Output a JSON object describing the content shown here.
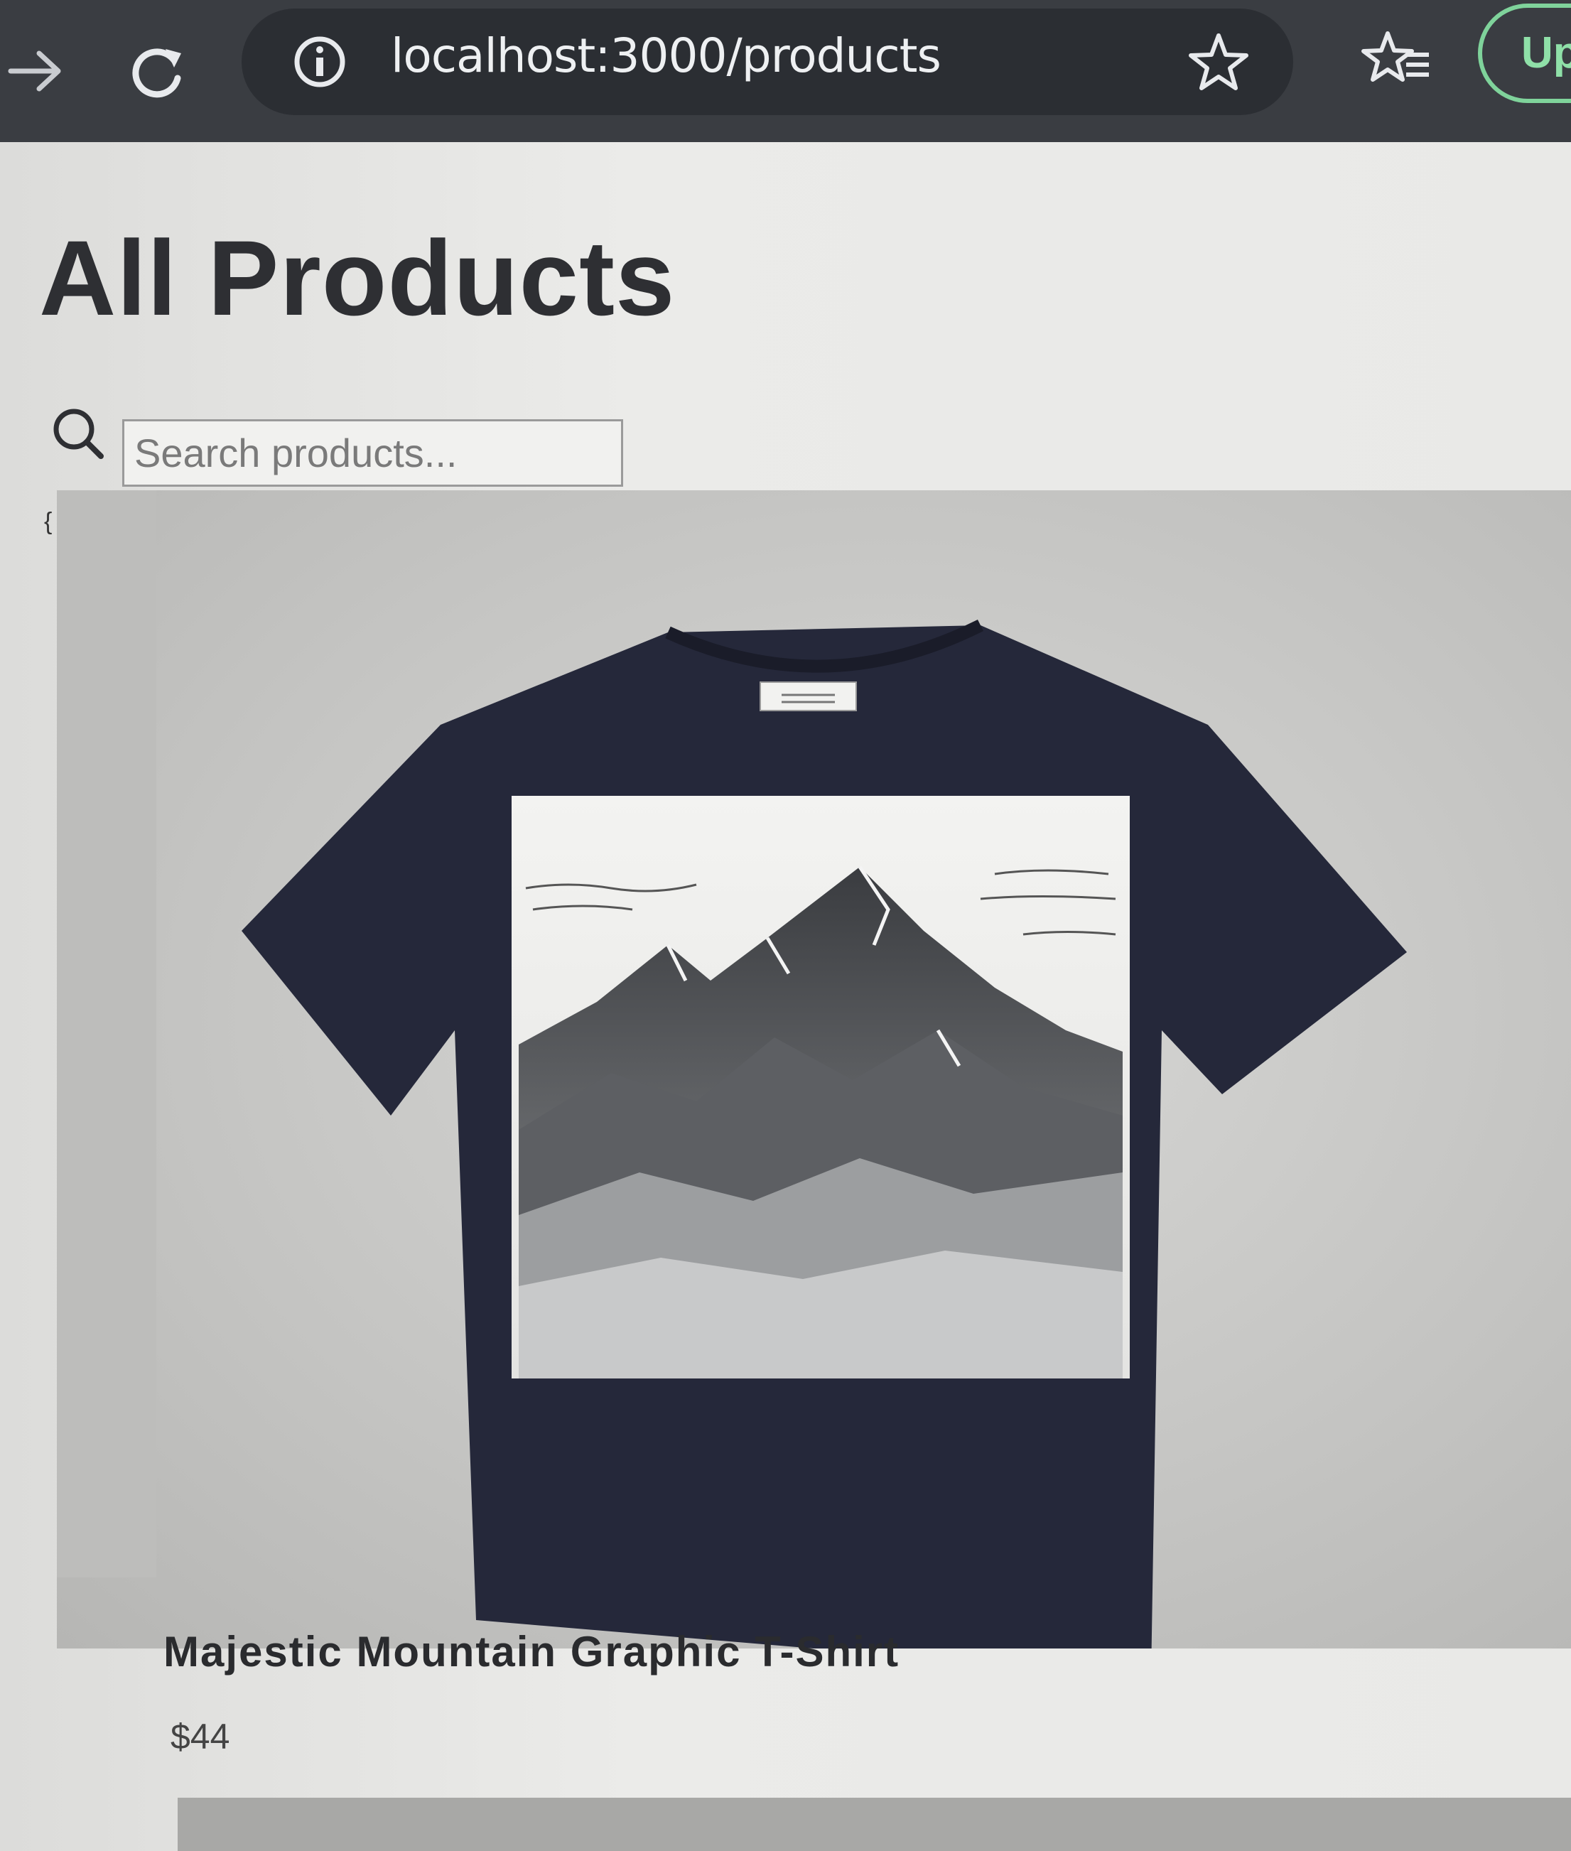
{
  "browser": {
    "url": "localhost:3000/products",
    "update_label": "Up",
    "icons": {
      "forward": "arrow-right-icon",
      "reload": "reload-icon",
      "site_info": "info-icon",
      "bookmark": "star-icon",
      "reading_list": "star-list-icon"
    },
    "colors": {
      "toolbar": "#3a3d42",
      "omnibox": "#2b2e33",
      "update_accent": "#7fd39b"
    }
  },
  "page": {
    "title": "All Products",
    "search": {
      "placeholder": "Search products...",
      "value": ""
    },
    "stray_mark": "{",
    "products": [
      {
        "name": "Majestic Mountain Graphic T-Shirt",
        "price": "$44",
        "image": "navy t-shirt with mountain range graphic"
      }
    ]
  }
}
